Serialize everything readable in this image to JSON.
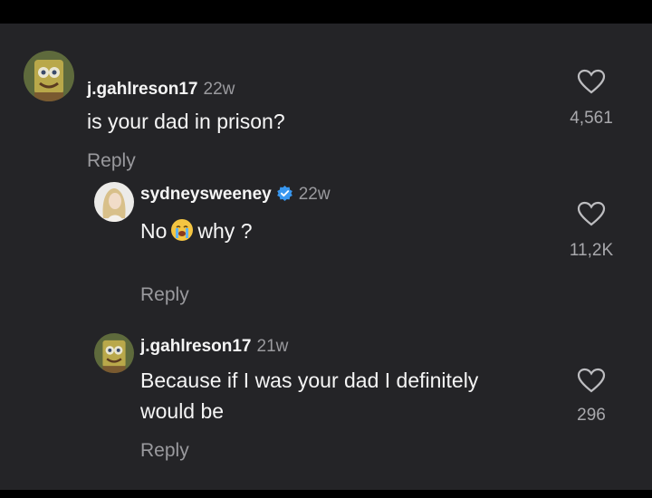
{
  "comments": [
    {
      "username": "j.gahlreson17",
      "time": "22w",
      "text": "is your dad in prison?",
      "reply": "Reply",
      "likes": "4,561",
      "avatar": "spongebob-avatar"
    },
    {
      "username": "sydneysweeney",
      "time": "22w",
      "text_before": "No",
      "emoji": "crying-face-emoji",
      "text_after": "why ?",
      "reply": "Reply",
      "likes": "11,2K",
      "verified": true,
      "avatar": "blonde-woman-avatar",
      "accent": "#3897f0"
    },
    {
      "username": "j.gahlreson17",
      "time": "21w",
      "text_line1": "Because if I was your dad I definitely",
      "text_line2": "would be",
      "reply": "Reply",
      "likes": "296",
      "avatar": "spongebob-avatar"
    }
  ],
  "icons": {
    "like": "heart-outline-icon"
  },
  "colors": {
    "background": "#242427",
    "muted": "#9a9a9e"
  }
}
